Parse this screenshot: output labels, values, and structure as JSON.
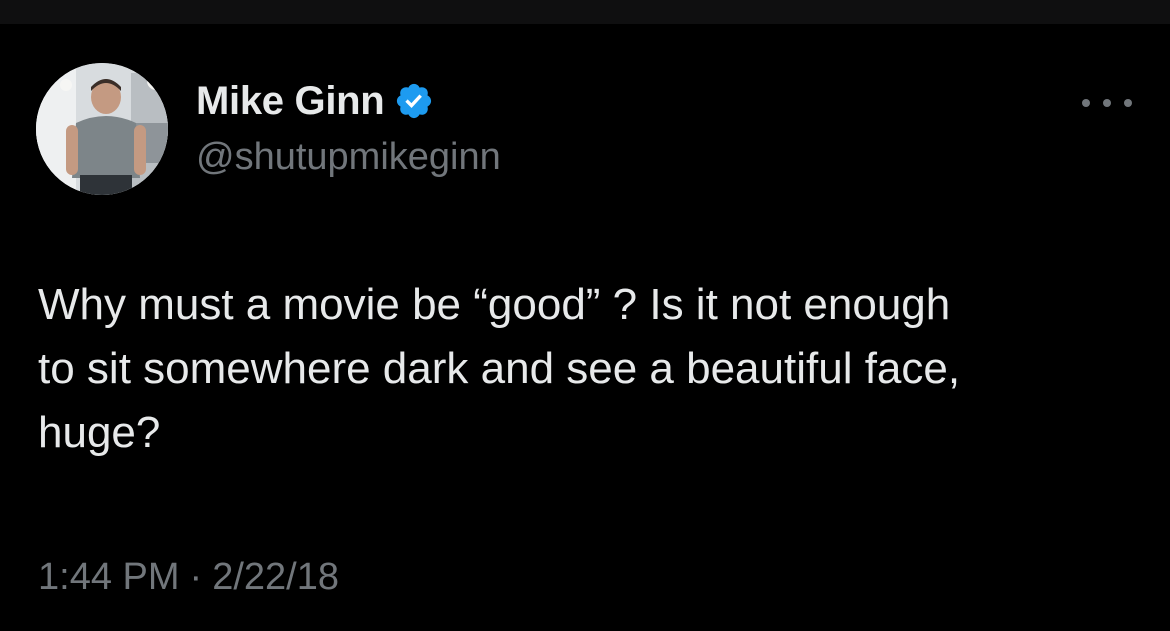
{
  "tweet": {
    "author": {
      "display_name": "Mike Ginn",
      "handle": "@shutupmikeginn",
      "verified_icon": "verified-badge-icon",
      "avatar_icon": "profile-photo"
    },
    "more_icon": "more-options-icon",
    "text": "Why must a movie be “good” ? Is it not enough\nto sit somewhere dark and see a beautiful face,\nhuge?",
    "time": "1:44 PM",
    "separator": "·",
    "date": "2/22/18"
  },
  "colors": {
    "background": "#000000",
    "primary_text": "#e7e9ea",
    "secondary_text": "#71767b",
    "verified_blue": "#1d9bf0"
  }
}
